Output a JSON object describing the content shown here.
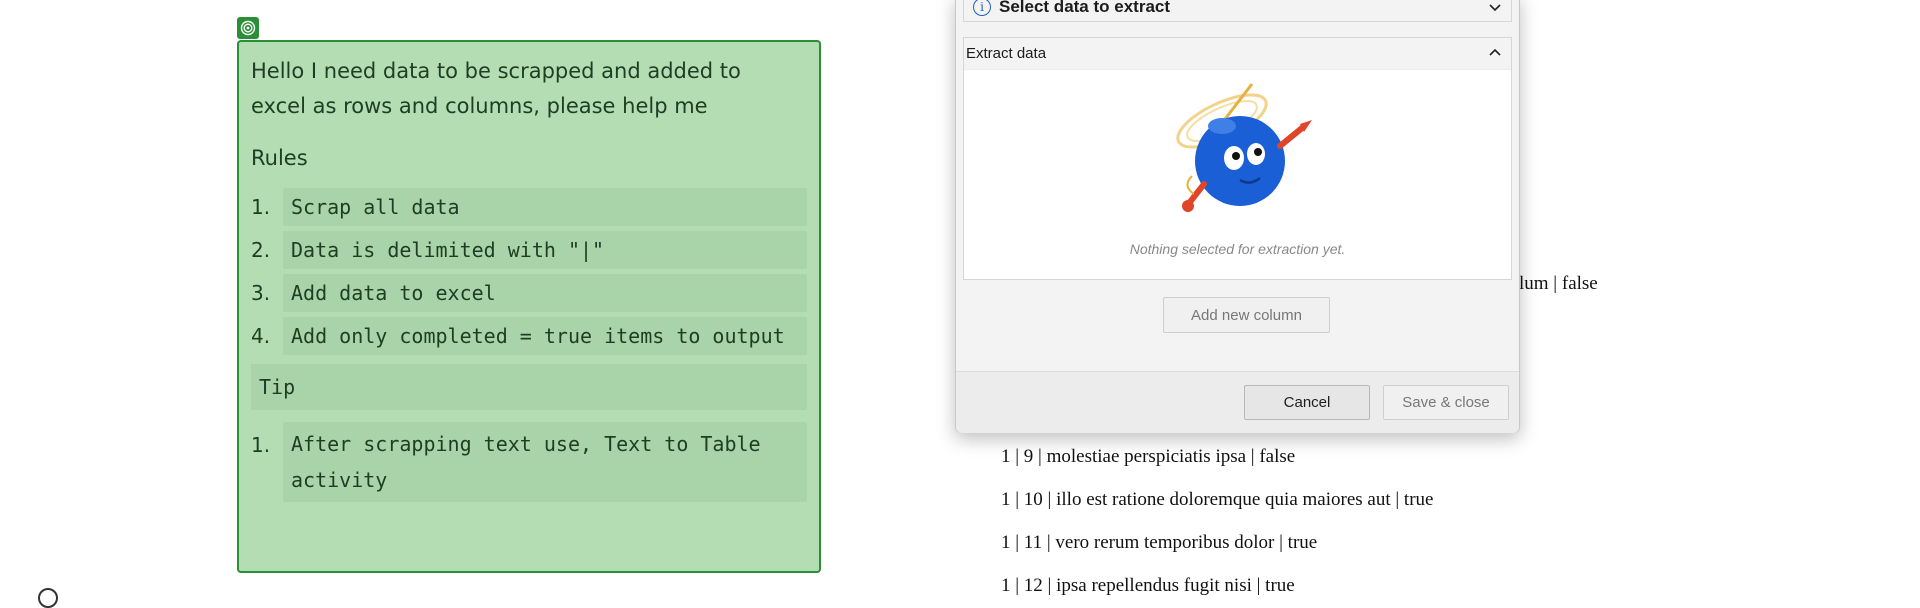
{
  "card": {
    "intro": "Hello I need data to be scrapped and added to excel as rows and columns, please help me",
    "rules_label": "Rules",
    "rules": [
      {
        "num": "1.",
        "text": "Scrap all data"
      },
      {
        "num": "2.",
        "text": "Data is delimited with \"|\""
      },
      {
        "num": "3.",
        "text": "Add data to excel"
      },
      {
        "num": "4.",
        "text": "Add only completed = true items to output"
      }
    ],
    "tip_label": "Tip",
    "tips": [
      {
        "num": "1.",
        "text": "After scrapping text use, Text to Table activity"
      }
    ],
    "badge_icon": "target-icon"
  },
  "background_list": {
    "partial_row": "lum | false",
    "rows": [
      "1 | 9 | molestiae perspiciatis ipsa | false",
      "1 | 10 | illo est ratione doloremque quia maiores aut | true",
      "1 | 11 | vero rerum temporibus dolor | true",
      "1 | 12 | ipsa repellendus fugit nisi | true"
    ]
  },
  "dialog": {
    "select_section_title": "Select data to extract",
    "extract_section_title": "Extract data",
    "empty_message": "Nothing selected for extraction yet.",
    "add_column_label": "Add new column",
    "cancel_label": "Cancel",
    "save_label": "Save & close",
    "colors": {
      "accent": "#2060c0",
      "mascot_blue": "#1a5fd6",
      "arm_red": "#e0452a"
    }
  }
}
